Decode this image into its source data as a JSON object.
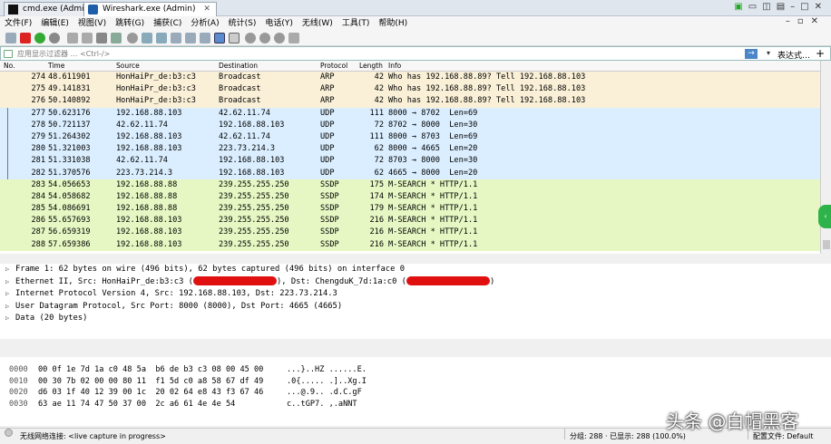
{
  "taskbar_tabs": [
    {
      "label": "cmd.exe (Admin)",
      "active": false
    },
    {
      "label": "Wireshark.exe (Admin)",
      "active": true
    }
  ],
  "menu": [
    "文件(F)",
    "编辑(E)",
    "视图(V)",
    "跳转(G)",
    "捕获(C)",
    "分析(A)",
    "统计(S)",
    "电话(Y)",
    "无线(W)",
    "工具(T)",
    "帮助(H)"
  ],
  "filter": {
    "placeholder": "应用显示过滤器 … <Ctrl-/>",
    "expression_label": "表达式…",
    "add_label": "+"
  },
  "packet_columns": [
    "No.",
    "Time",
    "Source",
    "Destination",
    "Protocol",
    "Length",
    "Info"
  ],
  "colors": {
    "arp_bg": "#faf0d7",
    "udp_bg": "#daeeff",
    "ssdp_bg": "#e6f7c3",
    "accent": "#4a86c8",
    "redaction": "#e01010"
  },
  "packets": [
    {
      "no": "274",
      "time": "48.611901",
      "src": "HonHaiPr_de:b3:c3",
      "dst": "Broadcast",
      "proto": "ARP",
      "len": "42",
      "info": "Who has 192.168.88.89? Tell 192.168.88.103",
      "kind": "arp"
    },
    {
      "no": "275",
      "time": "49.141831",
      "src": "HonHaiPr_de:b3:c3",
      "dst": "Broadcast",
      "proto": "ARP",
      "len": "42",
      "info": "Who has 192.168.88.89? Tell 192.168.88.103",
      "kind": "arp"
    },
    {
      "no": "276",
      "time": "50.140892",
      "src": "HonHaiPr_de:b3:c3",
      "dst": "Broadcast",
      "proto": "ARP",
      "len": "42",
      "info": "Who has 192.168.88.89? Tell 192.168.88.103",
      "kind": "arp"
    },
    {
      "no": "277",
      "time": "50.623176",
      "src": "192.168.88.103",
      "dst": "42.62.11.74",
      "proto": "UDP",
      "len": "111",
      "info": "8000 → 8702  Len=69",
      "kind": "udp"
    },
    {
      "no": "278",
      "time": "50.721137",
      "src": "42.62.11.74",
      "dst": "192.168.88.103",
      "proto": "UDP",
      "len": "72",
      "info": "8702 → 8000  Len=30",
      "kind": "udp"
    },
    {
      "no": "279",
      "time": "51.264302",
      "src": "192.168.88.103",
      "dst": "42.62.11.74",
      "proto": "UDP",
      "len": "111",
      "info": "8000 → 8703  Len=69",
      "kind": "udp"
    },
    {
      "no": "280",
      "time": "51.321003",
      "src": "192.168.88.103",
      "dst": "223.73.214.3",
      "proto": "UDP",
      "len": "62",
      "info": "8000 → 4665  Len=20",
      "kind": "udp"
    },
    {
      "no": "281",
      "time": "51.331038",
      "src": "42.62.11.74",
      "dst": "192.168.88.103",
      "proto": "UDP",
      "len": "72",
      "info": "8703 → 8000  Len=30",
      "kind": "udp"
    },
    {
      "no": "282",
      "time": "51.370576",
      "src": "223.73.214.3",
      "dst": "192.168.88.103",
      "proto": "UDP",
      "len": "62",
      "info": "4665 → 8000  Len=20",
      "kind": "udp"
    },
    {
      "no": "283",
      "time": "54.056653",
      "src": "192.168.88.88",
      "dst": "239.255.255.250",
      "proto": "SSDP",
      "len": "175",
      "info": "M-SEARCH * HTTP/1.1",
      "kind": "ssdp"
    },
    {
      "no": "284",
      "time": "54.058682",
      "src": "192.168.88.88",
      "dst": "239.255.255.250",
      "proto": "SSDP",
      "len": "174",
      "info": "M-SEARCH * HTTP/1.1",
      "kind": "ssdp"
    },
    {
      "no": "285",
      "time": "54.086691",
      "src": "192.168.88.88",
      "dst": "239.255.255.250",
      "proto": "SSDP",
      "len": "179",
      "info": "M-SEARCH * HTTP/1.1",
      "kind": "ssdp"
    },
    {
      "no": "286",
      "time": "55.657693",
      "src": "192.168.88.103",
      "dst": "239.255.255.250",
      "proto": "SSDP",
      "len": "216",
      "info": "M-SEARCH * HTTP/1.1",
      "kind": "ssdp"
    },
    {
      "no": "287",
      "time": "56.659319",
      "src": "192.168.88.103",
      "dst": "239.255.255.250",
      "proto": "SSDP",
      "len": "216",
      "info": "M-SEARCH * HTTP/1.1",
      "kind": "ssdp"
    },
    {
      "no": "288",
      "time": "57.659386",
      "src": "192.168.88.103",
      "dst": "239.255.255.250",
      "proto": "SSDP",
      "len": "216",
      "info": "M-SEARCH * HTTP/1.1",
      "kind": "ssdp"
    }
  ],
  "details": {
    "frame": "Frame 1: 62 bytes on wire (496 bits), 62 bytes captured (496 bits) on interface 0",
    "ethernet_prefix": "Ethernet II, Src: HonHaiPr_de:b3:c3 (",
    "ethernet_mid": "), Dst: ChengduK_7d:1a:c0 (",
    "ethernet_suffix": ")",
    "ip": "Internet Protocol Version 4, Src: 192.168.88.103, Dst: 223.73.214.3",
    "udp": "User Datagram Protocol, Src Port: 8000 (8000), Dst Port: 4665 (4665)",
    "data": "Data (20 bytes)"
  },
  "bytes": [
    {
      "offset": "0000",
      "hex": "00 0f 1e 7d 1a c0 48 5a  b6 de b3 c3 08 00 45 00",
      "ascii": "...}..HZ ......E."
    },
    {
      "offset": "0010",
      "hex": "00 30 7b 02 00 00 80 11  f1 5d c0 a8 58 67 df 49",
      "ascii": ".0{..... .]..Xg.I"
    },
    {
      "offset": "0020",
      "hex": "d6 03 1f 40 12 39 00 1c  20 02 64 e8 43 f3 67 46",
      "ascii": "...@.9.. .d.C.gF"
    },
    {
      "offset": "0030",
      "hex": "63 ae 11 74 47 50 37 00  2c a6 61 4e 4e 54",
      "ascii": "c..tGP7. ,.aNNT"
    }
  ],
  "status": {
    "capture": "无线网络连接: <live capture in progress>",
    "packets": "分组: 288 · 已显示: 288 (100.0%)",
    "profile": "配置文件: Default"
  },
  "watermark": "头条 @白帽黑客"
}
